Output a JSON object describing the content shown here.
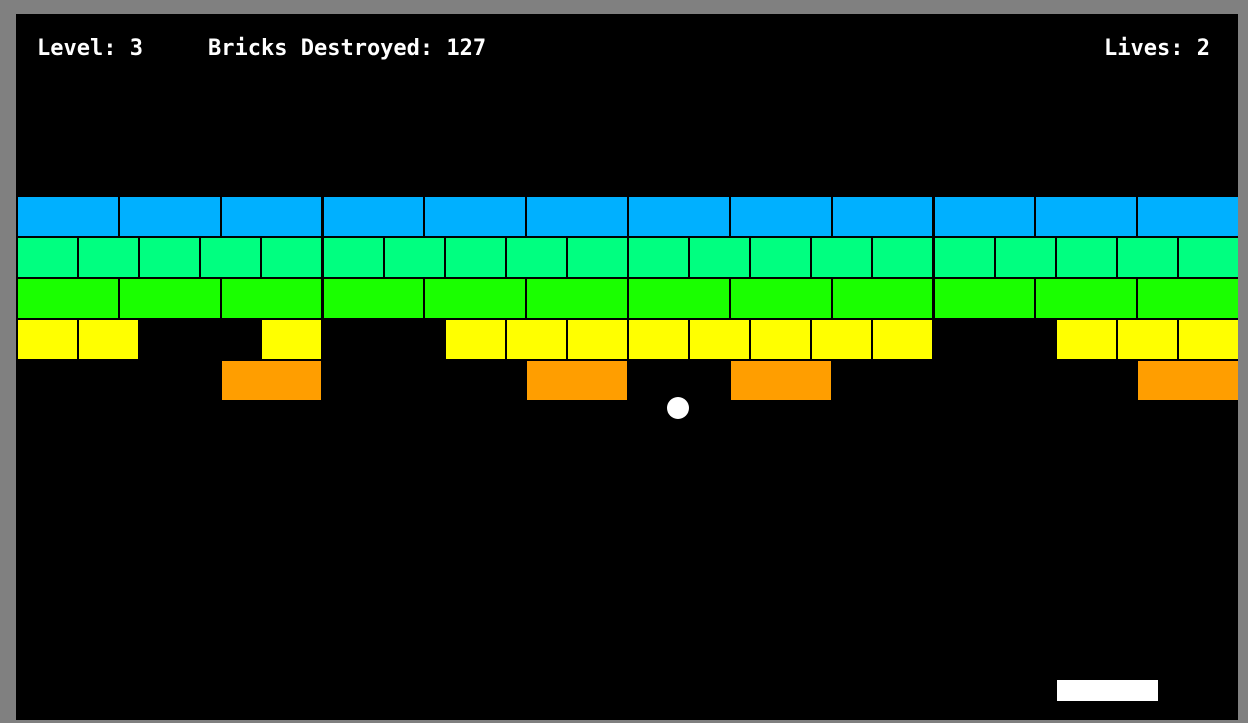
{
  "hud": {
    "level_text": "Level: 3",
    "bricks_text": "Bricks Destroyed: 127",
    "lives_text": "Lives: 2"
  },
  "colors": {
    "window_frame": "#808080",
    "playfield": "#000000",
    "row_blue": "#00b0ff",
    "row_teal": "#00ff80",
    "row_green": "#1aff00",
    "row_yellow": "#ffff00",
    "row_orange": "#ff9e00",
    "ball": "#ffffff",
    "paddle": "#ffffff"
  },
  "brick_rows": [
    {
      "name": "blue",
      "color": "#00b0ff",
      "columns": 12,
      "present": [
        1,
        1,
        1,
        1,
        1,
        1,
        1,
        1,
        1,
        1,
        1,
        1
      ]
    },
    {
      "name": "teal",
      "color": "#00ff80",
      "columns": 20,
      "present": [
        1,
        1,
        1,
        1,
        1,
        1,
        1,
        1,
        1,
        1,
        1,
        1,
        1,
        1,
        1,
        1,
        1,
        1,
        1,
        1
      ]
    },
    {
      "name": "green",
      "color": "#1aff00",
      "columns": 12,
      "present": [
        1,
        1,
        1,
        1,
        1,
        1,
        1,
        1,
        1,
        1,
        1,
        1
      ]
    },
    {
      "name": "yellow",
      "color": "#ffff00",
      "columns": 20,
      "present": [
        1,
        1,
        0,
        0,
        1,
        0,
        0,
        1,
        1,
        1,
        1,
        1,
        1,
        1,
        1,
        0,
        0,
        1,
        1,
        1
      ]
    },
    {
      "name": "orange",
      "color": "#ff9e00",
      "columns": 12,
      "present": [
        0,
        0,
        1,
        0,
        0,
        1,
        0,
        1,
        0,
        0,
        0,
        1
      ]
    }
  ]
}
